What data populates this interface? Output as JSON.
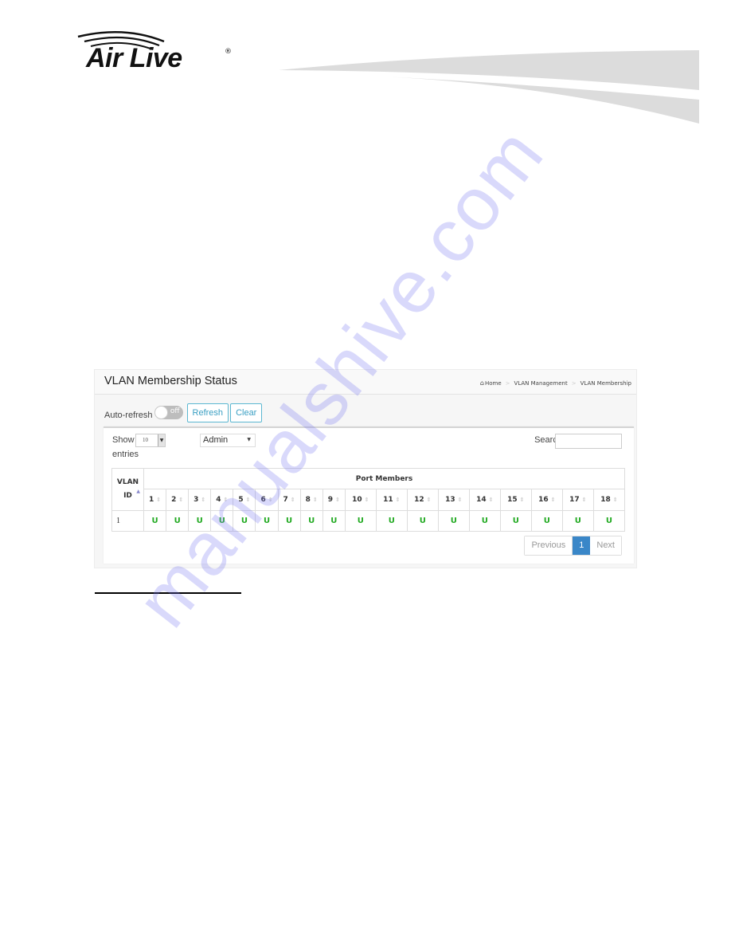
{
  "document": {
    "brand": {
      "logo_text": "Air Live",
      "registered_mark": "®"
    },
    "watermark": "manualshive.com"
  },
  "page": {
    "title": "VLAN Membership Status",
    "breadcrumb": [
      {
        "label": "Home",
        "icon": "home-icon"
      },
      {
        "label": "VLAN Management"
      },
      {
        "label": "VLAN Membership"
      }
    ],
    "breadcrumb_separator": ">"
  },
  "toolbar": {
    "auto_refresh_label": "Auto-refresh",
    "auto_refresh_state": "off",
    "refresh_label": "Refresh",
    "clear_label": "Clear"
  },
  "table_controls": {
    "show_label": "Show",
    "entries_label": "entries",
    "page_length": "10",
    "user_type": "Admin",
    "search_label": "Search:",
    "search_value": ""
  },
  "table": {
    "vlan_header": "VLAN ID",
    "vlan_header_line1": "VLAN",
    "vlan_header_line2": "ID",
    "port_members_header": "Port Members",
    "ports": [
      "1",
      "2",
      "3",
      "4",
      "5",
      "6",
      "7",
      "8",
      "9",
      "10",
      "11",
      "12",
      "13",
      "14",
      "15",
      "16",
      "17",
      "18"
    ],
    "rows": [
      {
        "vlan_id": "1",
        "members": [
          "U",
          "U",
          "U",
          "U",
          "U",
          "U",
          "U",
          "U",
          "U",
          "U",
          "U",
          "U",
          "U",
          "U",
          "U",
          "U",
          "U",
          "U"
        ]
      }
    ]
  },
  "pagination": {
    "previous_label": "Previous",
    "current_page": "1",
    "next_label": "Next"
  },
  "colors": {
    "member_untagged": "#22aa22",
    "active_page": "#3a87c8",
    "button_accent": "#3a9fc3"
  }
}
